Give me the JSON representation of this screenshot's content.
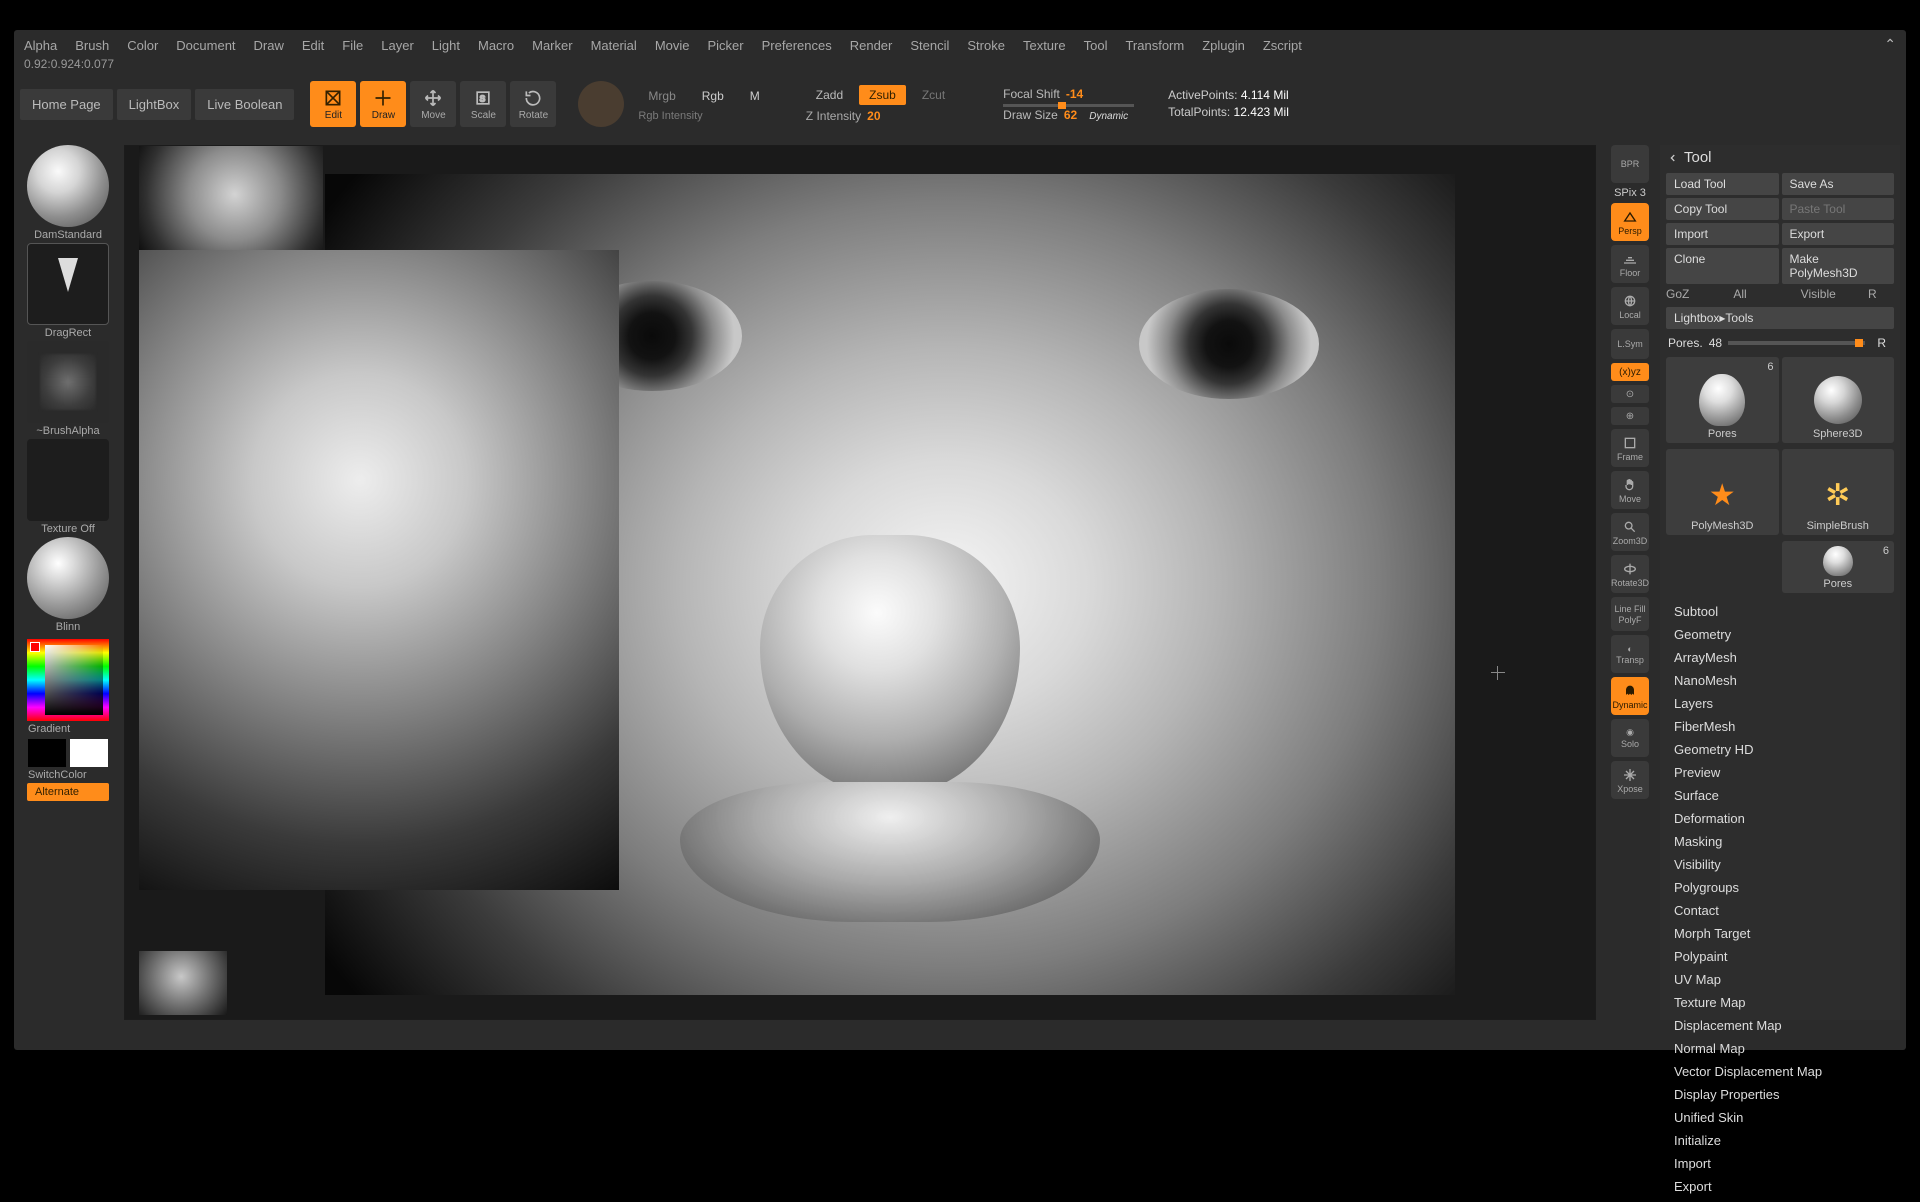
{
  "status_line": "0.92:0.924:0.077",
  "menu": [
    "Alpha",
    "Brush",
    "Color",
    "Document",
    "Draw",
    "Edit",
    "File",
    "Layer",
    "Light",
    "Macro",
    "Marker",
    "Material",
    "Movie",
    "Picker",
    "Preferences",
    "Render",
    "Stencil",
    "Stroke",
    "Texture",
    "Tool",
    "Transform",
    "Zplugin",
    "Zscript"
  ],
  "top_buttons": {
    "home": "Home Page",
    "lightbox": "LightBox",
    "liveboolean": "Live Boolean"
  },
  "mode_icons": {
    "edit": "Edit",
    "draw": "Draw",
    "move": "Move",
    "scale": "Scale",
    "rotate": "Rotate"
  },
  "color_modes": {
    "mrgb": "Mrgb",
    "rgb": "Rgb",
    "m": "M",
    "rgb_intensity": "Rgb Intensity"
  },
  "z_modes": {
    "zadd": "Zadd",
    "zsub": "Zsub",
    "zcut": "Zcut",
    "zintensity_label": "Z Intensity",
    "zintensity_val": "20"
  },
  "focal": {
    "label": "Focal Shift",
    "val": "-14"
  },
  "draw_size": {
    "label": "Draw Size",
    "val": "62",
    "dynamic": "Dynamic"
  },
  "stats": {
    "active_label": "ActivePoints:",
    "active_val": "4.114 Mil",
    "total_label": "TotalPoints:",
    "total_val": "12.423 Mil"
  },
  "left": {
    "brush": "DamStandard",
    "stroke": "DragRect",
    "alpha": "~BrushAlpha",
    "texture": "Texture Off",
    "material": "Blinn",
    "gradient": "Gradient",
    "switch": "SwitchColor",
    "alternate": "Alternate"
  },
  "right_shelf": {
    "bpr": "BPR",
    "spix": "SPix 3",
    "persp": "Persp",
    "floor": "Floor",
    "local": "Local",
    "lsym": "L.Sym",
    "sym_mode": "(x)yz",
    "frame": "Frame",
    "move": "Move",
    "zoom": "Zoom3D",
    "rot": "Rotate3D",
    "linefill": "Line Fill",
    "polyf": "PolyF",
    "transp": "Transp",
    "ghost": "Ghost",
    "solo": "Solo",
    "dynamic": "Dynamic",
    "xpose": "Xpose"
  },
  "tool": {
    "title": "Tool",
    "btns": {
      "load": "Load Tool",
      "save": "Save As",
      "copy": "Copy Tool",
      "paste": "Paste Tool",
      "import": "Import",
      "export": "Export",
      "clone": "Clone",
      "makepoly": "Make PolyMesh3D",
      "goz": "GoZ",
      "all": "All",
      "visible": "Visible",
      "r": "R",
      "lightboxtools": "Lightbox▸Tools"
    },
    "pores": {
      "label": "Pores.",
      "val": "48",
      "r": "R"
    },
    "thumbs": {
      "a": "Pores",
      "a_cnt": "6",
      "b": "Sphere3D",
      "c": "PolyMesh3D",
      "d": "SimpleBrush",
      "e": "Pores",
      "e_cnt": "6"
    },
    "sections": [
      "Subtool",
      "Geometry",
      "ArrayMesh",
      "NanoMesh",
      "Layers",
      "FiberMesh",
      "Geometry HD",
      "Preview",
      "Surface",
      "Deformation",
      "Masking",
      "Visibility",
      "Polygroups",
      "Contact",
      "Morph Target",
      "Polypaint",
      "UV Map",
      "Texture Map",
      "Displacement Map",
      "Normal Map",
      "Vector Displacement Map",
      "Display Properties",
      "Unified Skin",
      "Initialize",
      "Import",
      "Export"
    ]
  }
}
